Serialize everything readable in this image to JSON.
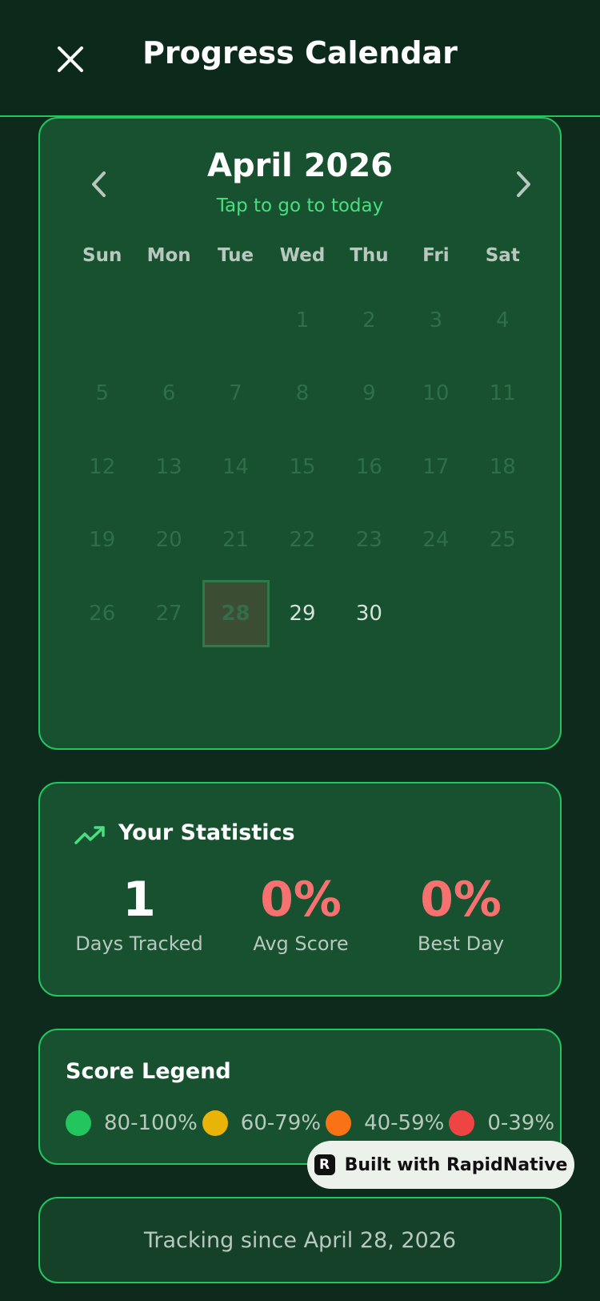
{
  "header": {
    "title": "Progress Calendar",
    "close_icon": "close-icon"
  },
  "calendar": {
    "month_label": "April 2026",
    "today_link": "Tap to go to today",
    "weekdays": [
      "Sun",
      "Mon",
      "Tue",
      "Wed",
      "Thu",
      "Fri",
      "Sat"
    ],
    "first_weekday_index": 3,
    "days_in_month": 30,
    "today": 28,
    "prev_icon": "chevron-left-icon",
    "next_icon": "chevron-right-icon"
  },
  "stats": {
    "title": "Your Statistics",
    "icon": "trending-up-icon",
    "items": [
      {
        "value": "1",
        "label": "Days Tracked",
        "color": "#ffffff"
      },
      {
        "value": "0%",
        "label": "Avg Score",
        "color": "#f87171"
      },
      {
        "value": "0%",
        "label": "Best Day",
        "color": "#f87171"
      }
    ]
  },
  "legend": {
    "title": "Score Legend",
    "items": [
      {
        "label": "80-100%",
        "color": "#22c55e"
      },
      {
        "label": "60-79%",
        "color": "#eab308"
      },
      {
        "label": "40-59%",
        "color": "#f97316"
      },
      {
        "label": "0-39%",
        "color": "#ef4444"
      }
    ]
  },
  "badge": {
    "text": "Built with RapidNative",
    "logo": "R"
  },
  "tracking": {
    "text": "Tracking since April 28, 2026"
  },
  "colors": {
    "accent": "#22c55e",
    "background": "#0d2a1c",
    "card": "#17512f"
  }
}
